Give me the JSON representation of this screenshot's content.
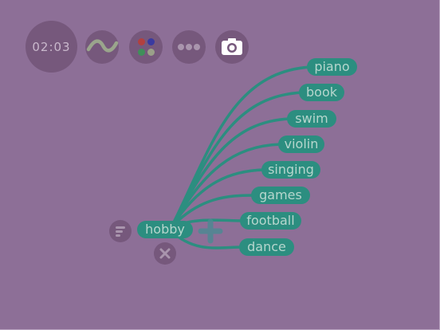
{
  "toolbar": {
    "timer": "02:03",
    "wave_icon": "wave-icon",
    "palette_icon": "palette-icon",
    "palette_colors": [
      "#b2403f",
      "#3a3aa0",
      "#3f8f5a",
      "#9aa089"
    ],
    "more_icon": "more-icon",
    "camera_icon": "camera-icon"
  },
  "mindmap": {
    "root": "hobby",
    "branches": [
      "piano",
      "book",
      "swim",
      "violin",
      "singing",
      "games",
      "football",
      "dance"
    ],
    "branch_color": "#2c8e80",
    "menu_icon": "menu-icon",
    "delete_icon": "close-icon",
    "add_icon": "plus-icon"
  },
  "colors": {
    "background": "#8d6f97",
    "button": "#76587c",
    "node_text": "#b6d6cd"
  }
}
